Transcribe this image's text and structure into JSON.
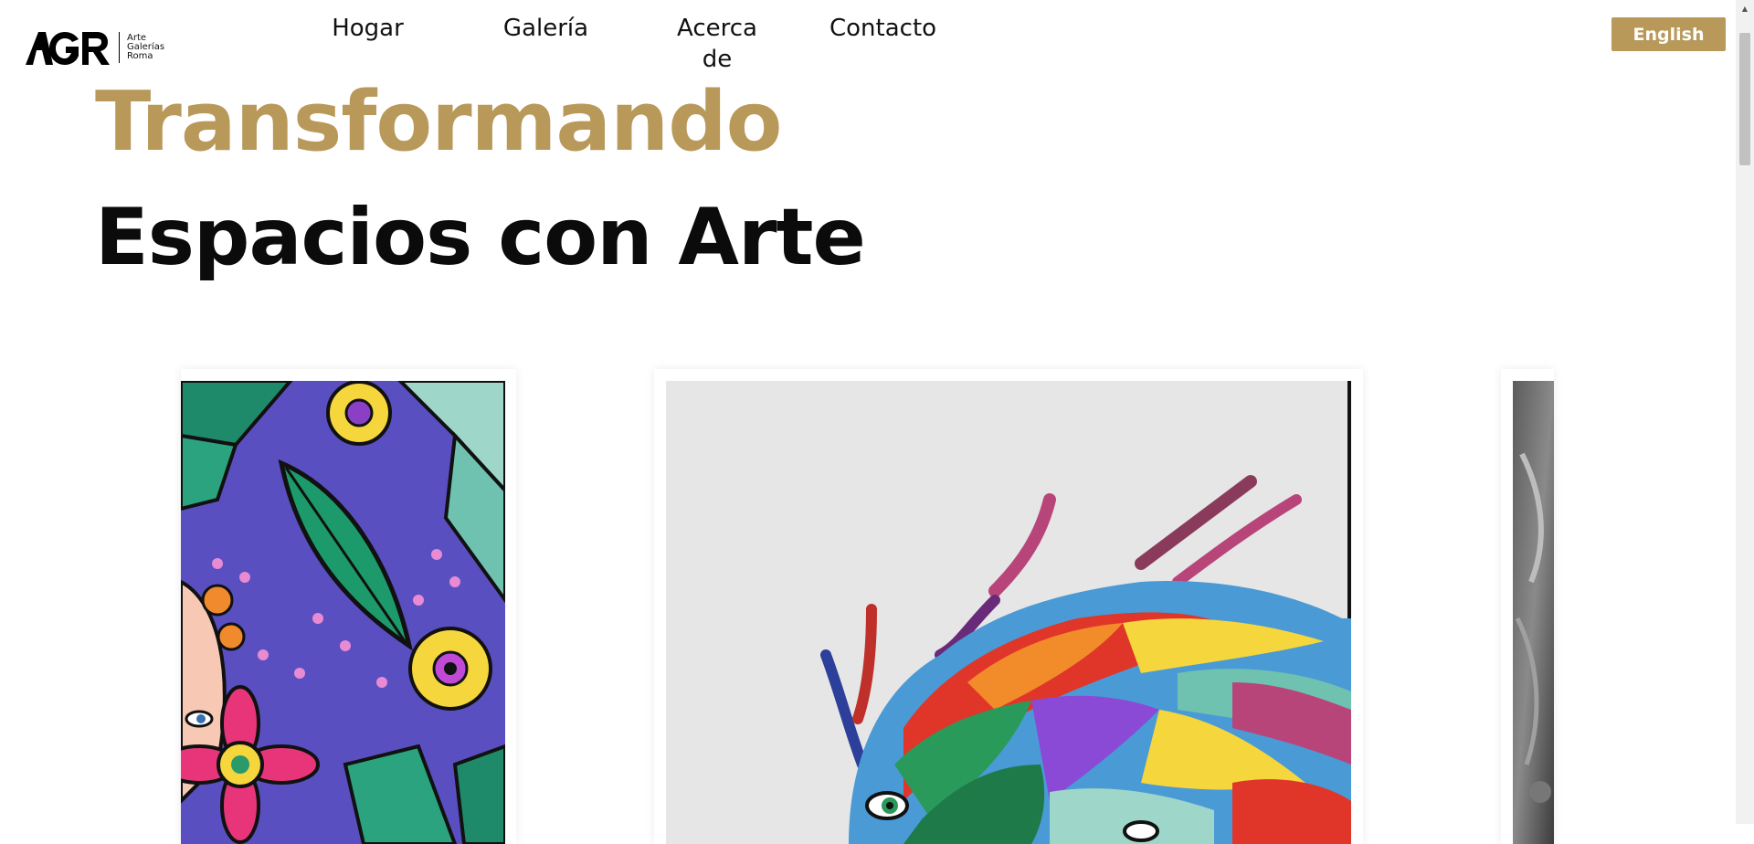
{
  "brand": {
    "logo_mark": "AGR",
    "logo_lines": [
      "Arte",
      "Galerías",
      "Roma"
    ]
  },
  "nav": {
    "items": [
      "Hogar",
      "Galería",
      "Acerca de",
      "Contacto"
    ]
  },
  "language_button": "English",
  "hero": {
    "line1": "Transformando",
    "line2": "Espacios con Arte"
  },
  "colors": {
    "accent": "#b8995a",
    "text": "#0b0b0b"
  },
  "gallery": {
    "artworks": [
      "floral-painting",
      "rainbow-lion-painting",
      "grayscale-painting"
    ]
  }
}
